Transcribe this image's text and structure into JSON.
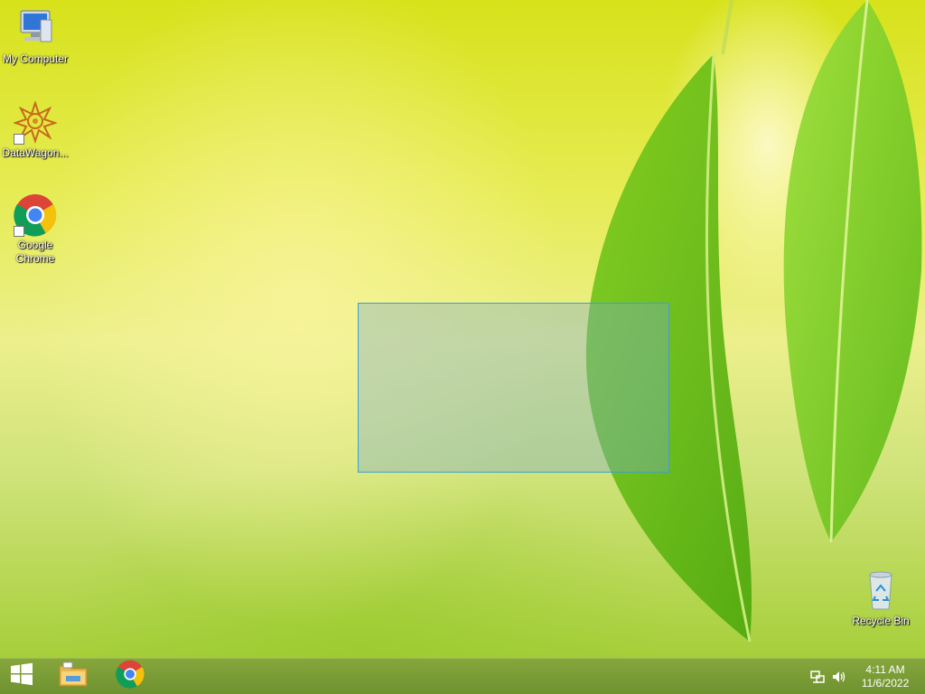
{
  "desktop": {
    "icons": [
      {
        "label": "My Computer",
        "icon": "computer-icon"
      },
      {
        "label": "DataWagon...",
        "icon": "datawagon-icon",
        "shortcut": true
      },
      {
        "label": "Google Chrome",
        "icon": "chrome-icon",
        "shortcut": true
      },
      {
        "label": "Recycle Bin",
        "icon": "recycle-bin-icon"
      }
    ]
  },
  "taskbar": {
    "start": {
      "icon": "windows-logo-icon"
    },
    "pinned": [
      {
        "icon": "file-explorer-icon"
      },
      {
        "icon": "chrome-icon"
      }
    ],
    "tray": {
      "icons": [
        "network-icon",
        "volume-icon"
      ],
      "time": "4:11 AM",
      "date": "11/6/2022"
    }
  },
  "colors": {
    "selection_border": "#3c9fd6",
    "taskbar": "#7a9b35"
  }
}
